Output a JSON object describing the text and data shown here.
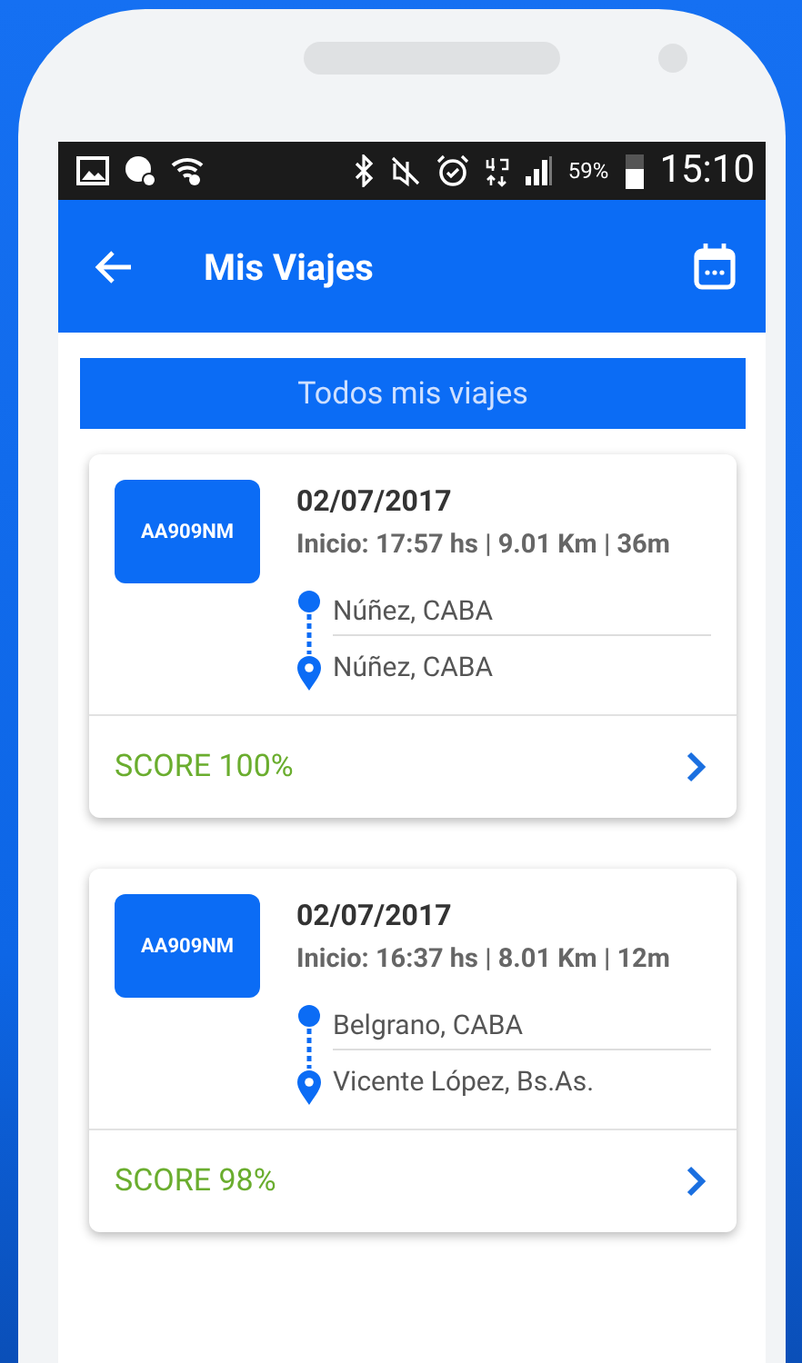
{
  "status_bar": {
    "battery": "59%",
    "time": "15:10"
  },
  "app_bar": {
    "title": "Mis Viajes"
  },
  "filter_button": "Todos mis viajes",
  "trips": [
    {
      "plate": "AA909NM",
      "date": "02/07/2017",
      "details": "Inicio: 17:57 hs | 9.01 Km | 36m",
      "origin": "Núñez, CABA",
      "destination": "Núñez, CABA",
      "score": "SCORE 100%"
    },
    {
      "plate": "AA909NM",
      "date": "02/07/2017",
      "details": "Inicio: 16:37 hs | 8.01 Km | 12m",
      "origin": "Belgrano, CABA",
      "destination": "Vicente López, Bs.As.",
      "score": "SCORE 98%"
    }
  ]
}
